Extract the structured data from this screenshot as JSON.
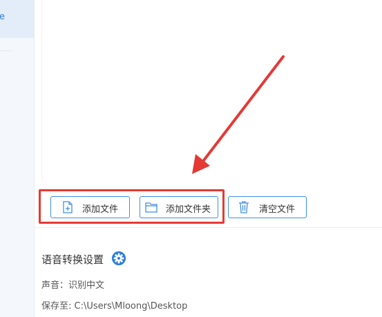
{
  "sidebar": {
    "active_item_label": "e"
  },
  "actions": {
    "add_file": "添加文件",
    "add_folder": "添加文件夹",
    "clear_files": "清空文件"
  },
  "settings": {
    "title": "语音转换设置",
    "voice_label": "声音：",
    "voice_value": "识别中文",
    "save_label": "保存至:",
    "save_path": "C:\\Users\\Mloong\\Desktop"
  },
  "annotation": {
    "highlight_color": "#e53935"
  },
  "colors": {
    "accent": "#3c8ee3",
    "sidebar_bg": "#f4f8fd"
  },
  "icons": {
    "add_file": "add-file-icon",
    "add_folder": "folder-icon",
    "clear": "trash-icon",
    "settings": "gear-icon"
  }
}
